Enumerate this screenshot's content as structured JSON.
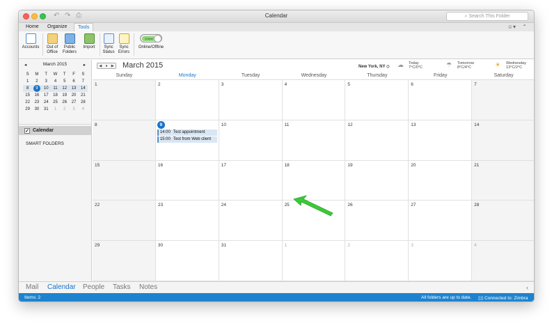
{
  "window": {
    "title": "Calendar"
  },
  "search": {
    "placeholder": "Search This Folder"
  },
  "tabs": [
    {
      "label": "Home"
    },
    {
      "label": "Organize"
    },
    {
      "label": "Tools"
    }
  ],
  "ribbon": {
    "accounts": "Accounts",
    "out_of_office_1": "Out of",
    "out_of_office_2": "Office",
    "public_folders_1": "Public",
    "public_folders_2": "Folders",
    "import": "Import",
    "sync_status_1": "Sync",
    "sync_status_2": "Status",
    "sync_errors_1": "Sync",
    "sync_errors_2": "Errors",
    "online_label": "Online/Offline",
    "online_toggle_text": "Online"
  },
  "mini_calendar": {
    "title": "March 2015",
    "weekdays": [
      "S",
      "M",
      "T",
      "W",
      "T",
      "F",
      "S"
    ],
    "weeks": [
      [
        "1",
        "2",
        "3",
        "4",
        "5",
        "6",
        "7"
      ],
      [
        "8",
        "9",
        "10",
        "11",
        "12",
        "13",
        "14"
      ],
      [
        "15",
        "16",
        "17",
        "18",
        "19",
        "20",
        "21"
      ],
      [
        "22",
        "23",
        "24",
        "25",
        "26",
        "27",
        "28"
      ],
      [
        "29",
        "30",
        "31",
        "1",
        "2",
        "3",
        "4"
      ]
    ]
  },
  "folders": {
    "calendar": "Calendar",
    "smart_folders": "SMART FOLDERS"
  },
  "main": {
    "title": "March 2015",
    "location": "New York, NY",
    "weather": [
      {
        "day": "Today",
        "temp": "7°C/0°C",
        "icon": "cloud-icon"
      },
      {
        "day": "Tomorrow",
        "temp": "8°C/4°C",
        "icon": "rain-icon"
      },
      {
        "day": "Wednesday",
        "temp": "13°C/2°C",
        "icon": "sun-cloud-icon"
      }
    ],
    "days": [
      "Sunday",
      "Monday",
      "Tuesday",
      "Wednesday",
      "Thursday",
      "Friday",
      "Saturday"
    ],
    "weeks": [
      [
        "1",
        "2",
        "3",
        "4",
        "5",
        "6",
        "7"
      ],
      [
        "8",
        "9",
        "10",
        "11",
        "12",
        "13",
        "14"
      ],
      [
        "15",
        "16",
        "17",
        "18",
        "19",
        "20",
        "21"
      ],
      [
        "22",
        "23",
        "24",
        "25",
        "26",
        "27",
        "28"
      ],
      [
        "29",
        "30",
        "31",
        "1",
        "2",
        "3",
        "4"
      ]
    ],
    "events": [
      {
        "time": "14:00",
        "title": "Test appointment"
      },
      {
        "time": "15:00",
        "title": "Test from Web client"
      }
    ]
  },
  "bottom_nav": [
    "Mail",
    "Calendar",
    "People",
    "Tasks",
    "Notes"
  ],
  "status": {
    "items": "Items: 2",
    "sync": "All folders are up to date.",
    "connection": "Connected to: Zimbra"
  },
  "colors": {
    "accent": "#1a73c7",
    "status_bar": "#1e83cf",
    "arrow": "#3cc83a"
  }
}
